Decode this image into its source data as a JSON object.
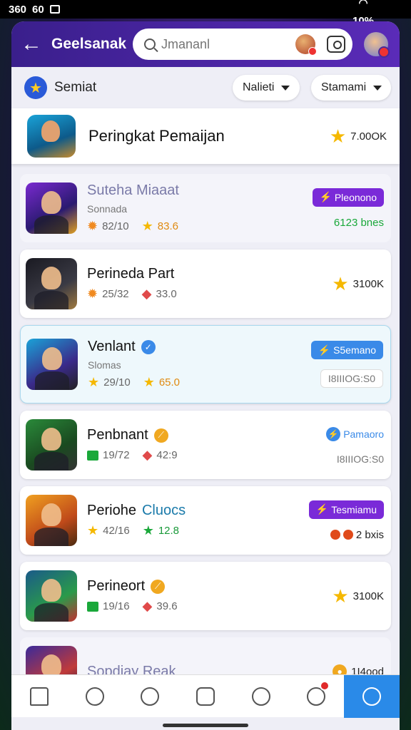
{
  "statusbar": {
    "time": "360",
    "time2": "60",
    "battery": "10%"
  },
  "topbar": {
    "title": "Geelsanak",
    "search_placeholder": "Jmananl"
  },
  "filterbar": {
    "label": "Semiat",
    "dropdown1": "Nalieti",
    "dropdown2": "Stamami"
  },
  "header": {
    "title": "Peringkat Pemaijan",
    "score": "7.00OK"
  },
  "rows": [
    {
      "name": "Suteha Miaaat",
      "sub": "Sonnada",
      "stat1": "82/10",
      "stat2": "83.6",
      "pill": "Pleonono",
      "right2": "6123 bnes"
    },
    {
      "name": "Perineda Part",
      "stat1": "25/32",
      "stat2": "33.0",
      "score": "3100K"
    },
    {
      "name": "Venlant",
      "sub": "Slomas",
      "stat1": "29/10",
      "stat2": "65.0",
      "pill": "S5emano",
      "right2": "I8IIIOG:S0"
    },
    {
      "name": "Penbnant",
      "stat1": "19/72",
      "stat2": "42:9",
      "pill": "Pamaoro",
      "right2": "I8IIIOG:S0"
    },
    {
      "name": "Periohe",
      "name_accent": "Cluocs",
      "stat1": "42/16",
      "stat2": "12.8",
      "pill": "Tesmiamu",
      "right2": "2 bxis"
    },
    {
      "name": "Perineort",
      "stat1": "19/16",
      "stat2": "39.6",
      "score": "3100K"
    },
    {
      "name": "Sopdiay Reak",
      "score": "1I4ood"
    }
  ],
  "icons": {
    "back": "arrow-left-icon",
    "search": "search-icon",
    "scan": "scan-icon",
    "nav": [
      "home-icon",
      "search-icon",
      "face-icon",
      "grid-icon",
      "heart-icon",
      "profile-icon",
      "chat-icon"
    ]
  },
  "colors": {
    "primary": "#4a28a8",
    "accent": "#2a8ae8",
    "star": "#f5b800",
    "pill_purple": "#7a2ad8"
  }
}
